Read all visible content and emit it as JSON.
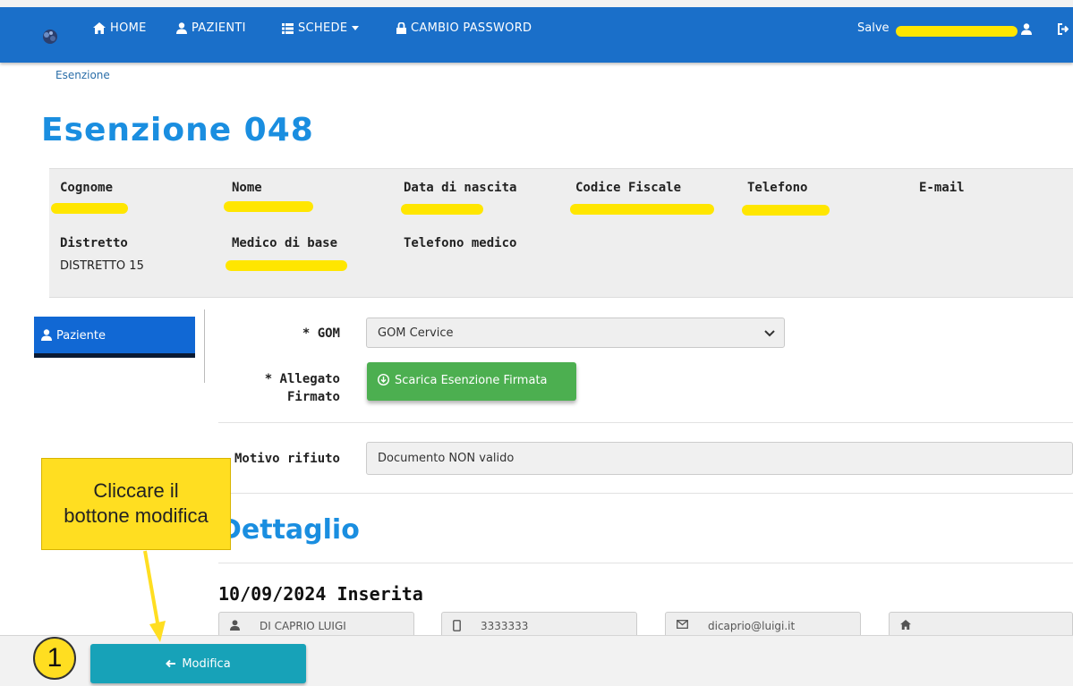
{
  "navbar": {
    "home": "HOME",
    "patients": "PAZIENTI",
    "cards": "SCHEDE",
    "change_password": "CAMBIO PASSWORD",
    "greeting": "Salve"
  },
  "breadcrumb": "Esenzione",
  "page_title": "Esenzione 048",
  "patient": {
    "labels": {
      "surname": "Cognome",
      "name": "Nome",
      "birth_date": "Data di nascita",
      "tax_code": "Codice Fiscale",
      "phone": "Telefono",
      "email": "E-mail",
      "district": "Distretto",
      "doctor": "Medico di base",
      "doctor_phone": "Telefono medico"
    },
    "district_value": "DISTRETTO 15"
  },
  "side_tab": {
    "label": "Paziente"
  },
  "form": {
    "gom_label": "* GOM",
    "gom_value": "GOM Cervice",
    "attachment_label_1": "* Allegato",
    "attachment_label_2": "Firmato",
    "download_button": "Scarica Esenzione Firmata",
    "refusal_label": "Motivo rifiuto",
    "refusal_value": "Documento NON valido"
  },
  "detail": {
    "title": "Dettaglio",
    "date_status": "10/09/2024 Inserita",
    "name": "DI CAPRIO LUIGI",
    "phone": "3333333",
    "email": "dicaprio@luigi.it"
  },
  "bottom": {
    "edit_button": "Modifica"
  },
  "annotation": {
    "callout_line_1": "Cliccare il",
    "callout_line_2": "bottone modifica",
    "step": "1"
  },
  "colors": {
    "navbar": "#1a6fc9",
    "title": "#1a8ee0",
    "green_button": "#4caf50",
    "edit_button": "#17a2b8",
    "annotation": "#ffde21"
  }
}
